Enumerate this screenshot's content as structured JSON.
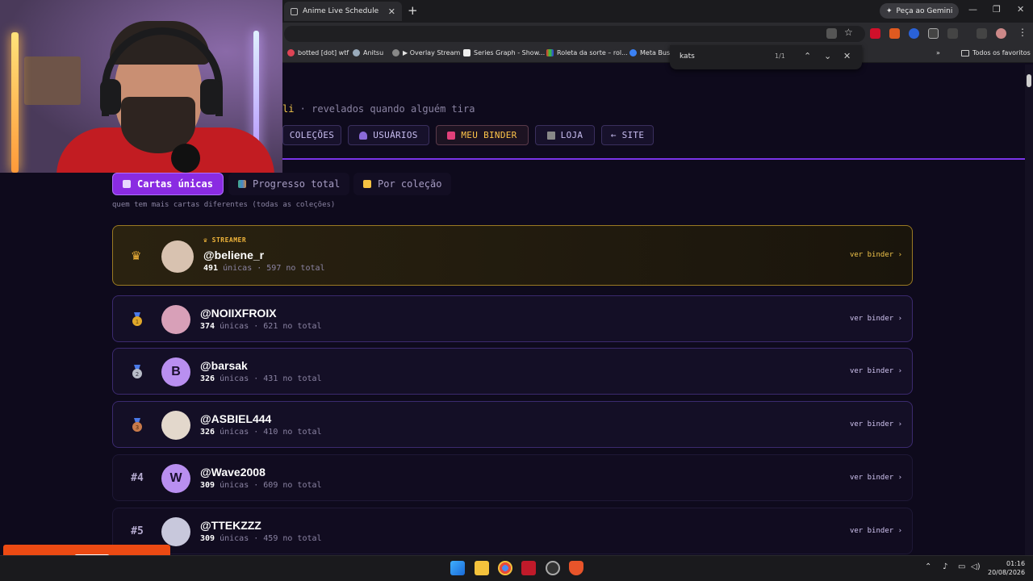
{
  "browser": {
    "tab_title": "Anime Live Schedule",
    "gemini_label": "Peça ao Gemini",
    "bookmarks": [
      "botted [dot] wtf",
      "Anitsu",
      "▶ Overlay Stream",
      "Series Graph - Show...",
      "Roleta da sorte – rol...",
      "Meta Busin"
    ],
    "all_bookmarks_label": "Todos os favoritos",
    "find": {
      "query": "kats",
      "count": "1/1"
    }
  },
  "page": {
    "subtitle_highlight": "li",
    "subtitle_rest": " · revelados quando alguém tira",
    "nav": [
      {
        "label": "COLEÇÕES",
        "icon": "collections-icon"
      },
      {
        "label": "USUÁRIOS",
        "icon": "users-icon"
      },
      {
        "label": "MEU BINDER",
        "icon": "binder-icon"
      },
      {
        "label": "LOJA",
        "icon": "shop-icon"
      },
      {
        "label": "← SITE",
        "icon": ""
      }
    ],
    "subtabs": [
      {
        "label": "Cartas únicas",
        "active": true
      },
      {
        "label": "Progresso total",
        "active": false
      },
      {
        "label": "Por coleção",
        "active": false
      }
    ],
    "hint": "quem tem mais cartas diferentes (todas as coleções)",
    "unique_label": "únicas",
    "total_label": "no total",
    "view_label": "ver binder ›",
    "streamer_badge": "STREAMER",
    "rows": [
      {
        "rank": "",
        "medal": "crown",
        "name": "@beliene_r",
        "unique": "491",
        "total": "597",
        "avatar_letter": "",
        "avatar_color": "#d8c2b0"
      },
      {
        "rank": "",
        "medal": "gold",
        "name": "@NOIIXFROIX",
        "unique": "374",
        "total": "621",
        "avatar_letter": "",
        "avatar_color": "#d8a0b8"
      },
      {
        "rank": "",
        "medal": "silver",
        "name": "@barsak",
        "unique": "326",
        "total": "431",
        "avatar_letter": "B",
        "avatar_color": "#b98ff0"
      },
      {
        "rank": "",
        "medal": "bronze",
        "name": "@ASBIEL444",
        "unique": "326",
        "total": "410",
        "avatar_letter": "",
        "avatar_color": "#e3d8cc"
      },
      {
        "rank": "#4",
        "medal": "",
        "name": "@Wave2008",
        "unique": "309",
        "total": "609",
        "avatar_letter": "W",
        "avatar_color": "#b98ff0"
      },
      {
        "rank": "#5",
        "medal": "",
        "name": "@TTEKZZZ",
        "unique": "309",
        "total": "459",
        "avatar_letter": "",
        "avatar_color": "#c8c8dc"
      }
    ]
  },
  "taskbar": {
    "time": "01:16",
    "date": "20/08/2026"
  },
  "colors": {
    "accent": "#8a2be2",
    "gold": "#f0c44a",
    "overlay": "#ec4a13"
  }
}
